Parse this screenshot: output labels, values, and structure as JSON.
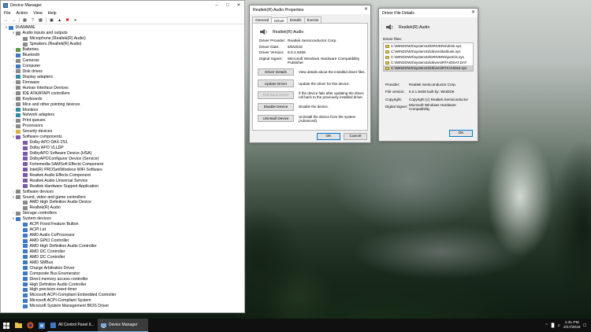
{
  "device_manager": {
    "title": "Device Manager",
    "menu": [
      "File",
      "Action",
      "View",
      "Help"
    ],
    "tree": [
      {
        "level": 0,
        "expanded": true,
        "label": "DHWAWIE",
        "icon": "computer-icon",
        "color": "blue"
      },
      {
        "level": 1,
        "expanded": true,
        "label": "Audio inputs and outputs",
        "icon": "speaker-icon",
        "color": "gray"
      },
      {
        "level": 2,
        "label": "Microphone (Realtek(R) Audio)",
        "icon": "microphone-icon",
        "color": "gray"
      },
      {
        "level": 2,
        "label": "Speakers (Realtek(R) Audio)",
        "icon": "speaker-icon",
        "color": "gray"
      },
      {
        "level": 1,
        "expanded": false,
        "label": "Batteries",
        "icon": "battery-icon",
        "color": "green"
      },
      {
        "level": 1,
        "expanded": false,
        "label": "Bluetooth",
        "icon": "bluetooth-icon",
        "color": "blue"
      },
      {
        "level": 1,
        "expanded": false,
        "label": "Cameras",
        "icon": "camera-icon",
        "color": "gray"
      },
      {
        "level": 1,
        "expanded": false,
        "label": "Computer",
        "icon": "computer-icon",
        "color": "blue"
      },
      {
        "level": 1,
        "expanded": false,
        "label": "Disk drives",
        "icon": "disk-icon",
        "color": "gray"
      },
      {
        "level": 1,
        "expanded": false,
        "label": "Display adapters",
        "icon": "display-icon",
        "color": "teal"
      },
      {
        "level": 1,
        "expanded": false,
        "label": "Firmware",
        "icon": "firmware-icon",
        "color": "gray"
      },
      {
        "level": 1,
        "expanded": false,
        "label": "Human Interface Devices",
        "icon": "hid-icon",
        "color": "gray"
      },
      {
        "level": 1,
        "expanded": false,
        "label": "IDE ATA/ATAPI controllers",
        "icon": "controller-icon",
        "color": "gray"
      },
      {
        "level": 1,
        "expanded": false,
        "label": "Keyboards",
        "icon": "keyboard-icon",
        "color": "gray"
      },
      {
        "level": 1,
        "expanded": false,
        "label": "Mice and other pointing devices",
        "icon": "mouse-icon",
        "color": "gray"
      },
      {
        "level": 1,
        "expanded": false,
        "label": "Monitors",
        "icon": "monitor-icon",
        "color": "teal"
      },
      {
        "level": 1,
        "expanded": false,
        "label": "Network adapters",
        "icon": "network-icon",
        "color": "teal"
      },
      {
        "level": 1,
        "expanded": false,
        "label": "Print queues",
        "icon": "printer-icon",
        "color": "gray"
      },
      {
        "level": 1,
        "expanded": false,
        "label": "Processors",
        "icon": "processor-icon",
        "color": "gray"
      },
      {
        "level": 1,
        "expanded": false,
        "label": "Security devices",
        "icon": "security-icon",
        "color": "yellow"
      },
      {
        "level": 1,
        "expanded": true,
        "label": "Software components",
        "icon": "component-icon",
        "color": "purple"
      },
      {
        "level": 2,
        "label": "Dolby APO DAX-2S1",
        "icon": "component-icon",
        "color": "purple"
      },
      {
        "level": 2,
        "label": "Dolby APO VLLDP",
        "icon": "component-icon",
        "color": "purple"
      },
      {
        "level": 2,
        "label": "DolbyAPO Software Device (HSA)",
        "icon": "component-icon",
        "color": "purple"
      },
      {
        "level": 2,
        "label": "DolbyAPOConfiguror Device (Service)",
        "icon": "component-icon",
        "color": "purple"
      },
      {
        "level": 2,
        "label": "Fortemedia SAMSoft Effects Component",
        "icon": "component-icon",
        "color": "purple"
      },
      {
        "level": 2,
        "label": "Intel(R) PROSet/Wireless WiFi Software",
        "icon": "component-icon",
        "color": "purple"
      },
      {
        "level": 2,
        "label": "Realtek Audio Effects Component",
        "icon": "component-icon",
        "color": "purple"
      },
      {
        "level": 2,
        "label": "Realtek Audio Universal Service",
        "icon": "component-icon",
        "color": "purple"
      },
      {
        "level": 2,
        "label": "Realtek Hardware Support Application",
        "icon": "component-icon",
        "color": "purple"
      },
      {
        "level": 1,
        "expanded": false,
        "label": "Software devices",
        "icon": "software-device-icon",
        "color": "gray"
      },
      {
        "level": 1,
        "expanded": true,
        "label": "Sound, video and game controllers",
        "icon": "sound-icon",
        "color": "gray"
      },
      {
        "level": 2,
        "label": "AMD High Definition Audio Device",
        "icon": "sound-icon",
        "color": "gray"
      },
      {
        "level": 2,
        "label": "Realtek(R) Audio",
        "icon": "sound-icon",
        "color": "gray"
      },
      {
        "level": 1,
        "expanded": false,
        "label": "Storage controllers",
        "icon": "storage-icon",
        "color": "gray"
      },
      {
        "level": 1,
        "expanded": true,
        "label": "System devices",
        "icon": "system-icon",
        "color": "blue"
      },
      {
        "level": 2,
        "label": "ACPI Fixed Feature Button",
        "icon": "system-icon",
        "color": "blue"
      },
      {
        "level": 2,
        "label": "ACPI Lid",
        "icon": "system-icon",
        "color": "blue"
      },
      {
        "level": 2,
        "label": "AMD Audio CoProcessor",
        "icon": "system-icon",
        "color": "blue"
      },
      {
        "level": 2,
        "label": "AMD GPIO Controller",
        "icon": "system-icon",
        "color": "blue"
      },
      {
        "level": 2,
        "label": "AMD High Definition Audio Controller",
        "icon": "system-icon",
        "color": "blue"
      },
      {
        "level": 2,
        "label": "AMD I2C Controller",
        "icon": "system-icon",
        "color": "blue"
      },
      {
        "level": 2,
        "label": "AMD I2C Controller",
        "icon": "system-icon",
        "color": "blue"
      },
      {
        "level": 2,
        "label": "AMD SMBus",
        "icon": "system-icon",
        "color": "blue"
      },
      {
        "level": 2,
        "label": "Charge Arbitration Driver",
        "icon": "system-icon",
        "color": "blue"
      },
      {
        "level": 2,
        "label": "Composite Bus Enumerator",
        "icon": "system-icon",
        "color": "blue"
      },
      {
        "level": 2,
        "label": "Direct memory access controller",
        "icon": "system-icon",
        "color": "blue"
      },
      {
        "level": 2,
        "label": "High Definition Audio Controller",
        "icon": "system-icon",
        "color": "blue"
      },
      {
        "level": 2,
        "label": "High precision event timer",
        "icon": "system-icon",
        "color": "blue"
      },
      {
        "level": 2,
        "label": "Microsoft ACPI-Compliant Embedded Controller",
        "icon": "system-icon",
        "color": "blue"
      },
      {
        "level": 2,
        "label": "Microsoft ACPI-Compliant System",
        "icon": "system-icon",
        "color": "blue"
      },
      {
        "level": 2,
        "label": "Microsoft System Management BIOS Driver",
        "icon": "system-icon",
        "color": "blue"
      }
    ]
  },
  "properties": {
    "title": "Realtek(R) Audio Properties",
    "tabs": [
      "General",
      "Driver",
      "Details",
      "Events"
    ],
    "active_tab": "Driver",
    "device_name": "Realtek(R) Audio",
    "fields": [
      {
        "label": "Driver Provider:",
        "value": "Realtek Semiconductor Corp."
      },
      {
        "label": "Driver Date:",
        "value": "6/5/2018"
      },
      {
        "label": "Driver Version:",
        "value": "6.0.1.8459"
      },
      {
        "label": "Digital Signer:",
        "value": "Microsoft Windows Hardware Compatibility Publisher"
      }
    ],
    "actions": [
      {
        "button": "Driver Details",
        "desc": "View details about the installed driver files.",
        "disabled": false
      },
      {
        "button": "Update Driver",
        "desc": "Update the driver for this device.",
        "disabled": false
      },
      {
        "button": "Roll Back Driver",
        "desc": "If the device fails after updating the driver, roll back to the previously installed driver.",
        "disabled": true
      },
      {
        "button": "Disable Device",
        "desc": "Disable the device.",
        "disabled": false
      },
      {
        "button": "Uninstall Device",
        "desc": "Uninstall the device from the system (Advanced).",
        "disabled": false
      }
    ],
    "ok_label": "OK",
    "cancel_label": "Cancel"
  },
  "file_details": {
    "title": "Driver File Details",
    "device_name": "Realtek(R) Audio",
    "files_label": "Driver files:",
    "files": [
      "C:\\WINDOWS\\system32\\DRIVERS\\drmk.sys",
      "C:\\WINDOWS\\system32\\drivers\\ksthunk.sys",
      "C:\\WINDOWS\\system32\\DRIVERS\\portcls.sys",
      "C:\\WINDOWS\\system32\\drivers\\RTAIODAT.DAT",
      "C:\\WINDOWS\\system32\\drivers\\RTKVHD64.sys"
    ],
    "selected_file_index": 4,
    "details": [
      {
        "label": "Provider:",
        "value": "Realtek Semiconductor Corp."
      },
      {
        "label": "File version:",
        "value": "6.0.1.8459 built by: WinDDK"
      },
      {
        "label": "Copyright:",
        "value": "Copyright (c) Realtek Semiconductor"
      },
      {
        "label": "Digital Signer:",
        "value": "Microsoft Windows Hardware Compatibility"
      }
    ],
    "ok_label": "OK"
  },
  "taskbar": {
    "tasks": [
      {
        "label": "All Control Panel It...",
        "active": false
      },
      {
        "label": "Device Manager",
        "active": true
      }
    ],
    "time": "1:31 PM",
    "date": "2/17/2019"
  },
  "colors": {
    "accent": "#0078d7",
    "taskbar": "#101010",
    "selection": "#cce8ff"
  }
}
